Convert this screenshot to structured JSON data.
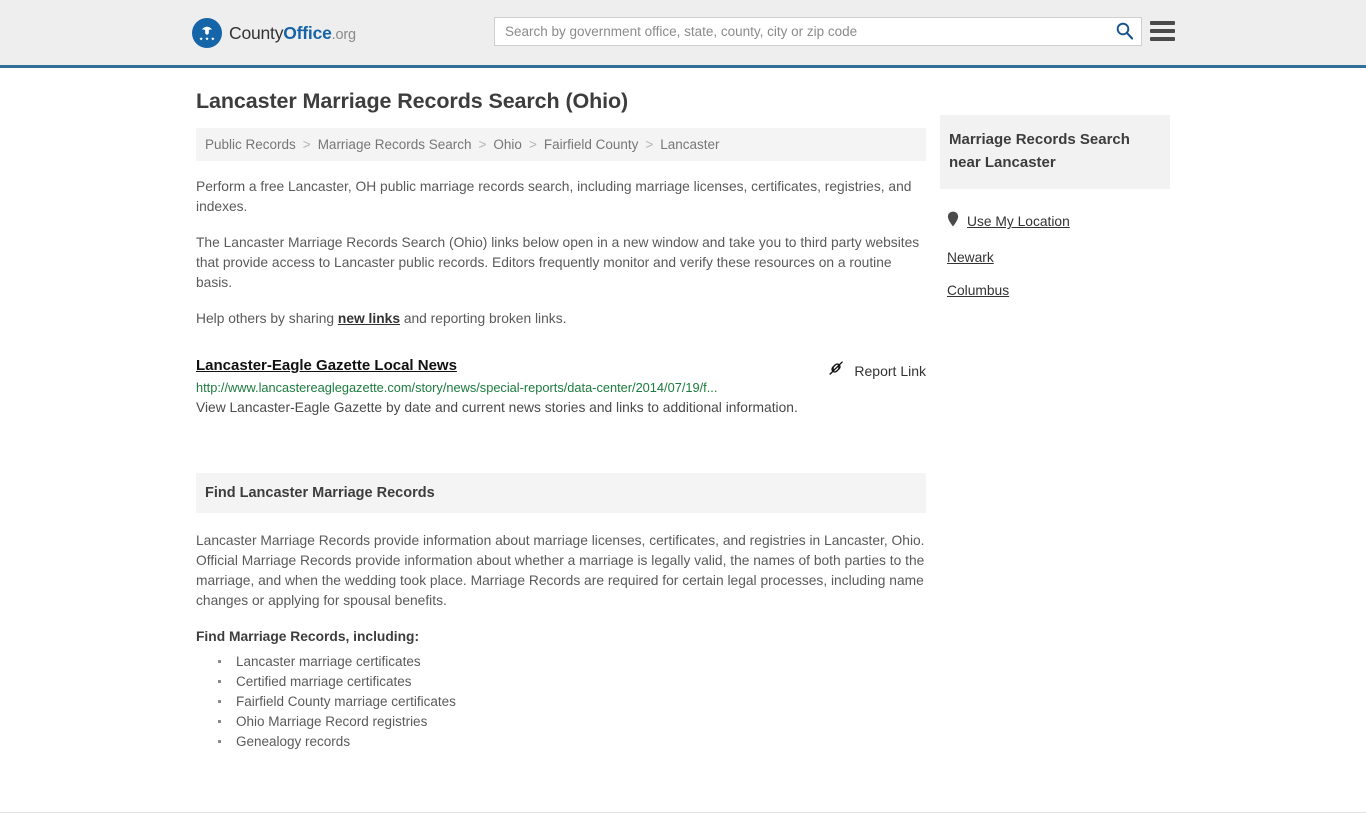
{
  "header": {
    "logo": {
      "icon": "eagle-seal-icon",
      "part1": "County",
      "part2": "Office",
      "tld": ".org"
    },
    "search": {
      "placeholder": "Search by government office, state, county, city or zip code",
      "value": "",
      "search_icon": "search-icon"
    },
    "menu_icon": "hamburger-menu-icon",
    "accent_color": "#337099"
  },
  "main": {
    "title": "Lancaster Marriage Records Search (Ohio)",
    "breadcrumb": {
      "separator": ">",
      "items": [
        "Public Records",
        "Marriage Records Search",
        "Ohio",
        "Fairfield County",
        "Lancaster"
      ]
    },
    "intro_paragraph": "Perform a free Lancaster, OH public marriage records search, including marriage licenses, certificates, registries, and indexes.",
    "description_paragraph": "The Lancaster Marriage Records Search (Ohio) links below open in a new window and take you to third party websites that provide access to Lancaster public records. Editors frequently monitor and verify these resources on a routine basis.",
    "help_text_before": "Help others by sharing ",
    "help_link": "new links",
    "help_text_after": " and reporting broken links.",
    "result": {
      "title": "Lancaster-Eagle Gazette Local News",
      "url": "http://www.lancastereaglegazette.com/story/news/special-reports/data-center/2014/07/19/f...",
      "description": "View Lancaster-Eagle Gazette by date and current news stories and links to additional information.",
      "report_label": "Report Link",
      "report_icon": "broken-link-icon",
      "url_color": "#1c7c3e"
    },
    "section": {
      "heading": "Find Lancaster Marriage Records",
      "paragraph": "Lancaster Marriage Records provide information about marriage licenses, certificates, and registries in Lancaster, Ohio. Official Marriage Records provide information about whether a marriage is legally valid, the names of both parties to the marriage, and when the wedding took place. Marriage Records are required for certain legal processes, including name changes or applying for spousal benefits.",
      "subheading": "Find Marriage Records, including:",
      "bullets": [
        "Lancaster marriage certificates",
        "Certified marriage certificates",
        "Fairfield County marriage certificates",
        "Ohio Marriage Record registries",
        "Genealogy records"
      ]
    }
  },
  "sidebar": {
    "heading": "Marriage Records Search near Lancaster",
    "links": [
      {
        "label": "Use My Location",
        "icon": "map-pin-icon"
      },
      {
        "label": "Newark",
        "icon": ""
      },
      {
        "label": "Columbus",
        "icon": ""
      }
    ]
  }
}
